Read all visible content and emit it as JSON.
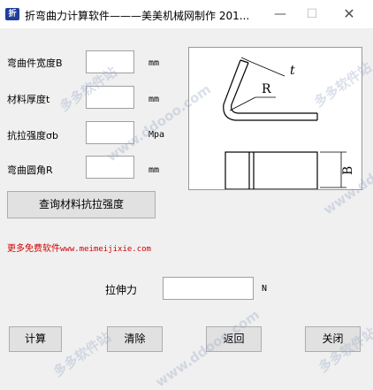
{
  "window": {
    "title": "折弯曲力计算软件———美美机械网制作  201...",
    "icon": "app-icon"
  },
  "fields": {
    "width": {
      "label": "弯曲件宽度B",
      "unit": "mm",
      "value": ""
    },
    "thickness": {
      "label": "材料厚度t",
      "unit": "mm",
      "value": ""
    },
    "strength": {
      "label": "抗拉强度σb",
      "unit": "Mpa",
      "value": ""
    },
    "radius": {
      "label": "弯曲圆角R",
      "unit": "mm",
      "value": ""
    }
  },
  "lookup_button": "查询材料抗拉强度",
  "promo": {
    "text": "更多免费软件",
    "url": "www.meimeijixie.com"
  },
  "diagram": {
    "label_t": "t",
    "label_r": "R",
    "label_b": "B"
  },
  "result": {
    "label": "拉伸力",
    "unit": "N",
    "value": ""
  },
  "buttons": {
    "calc": "计算",
    "clear": "清除",
    "back": "返回",
    "close": "关闭"
  },
  "watermark": {
    "text1": "多多软件站",
    "text2": "www.ddooo.com"
  }
}
